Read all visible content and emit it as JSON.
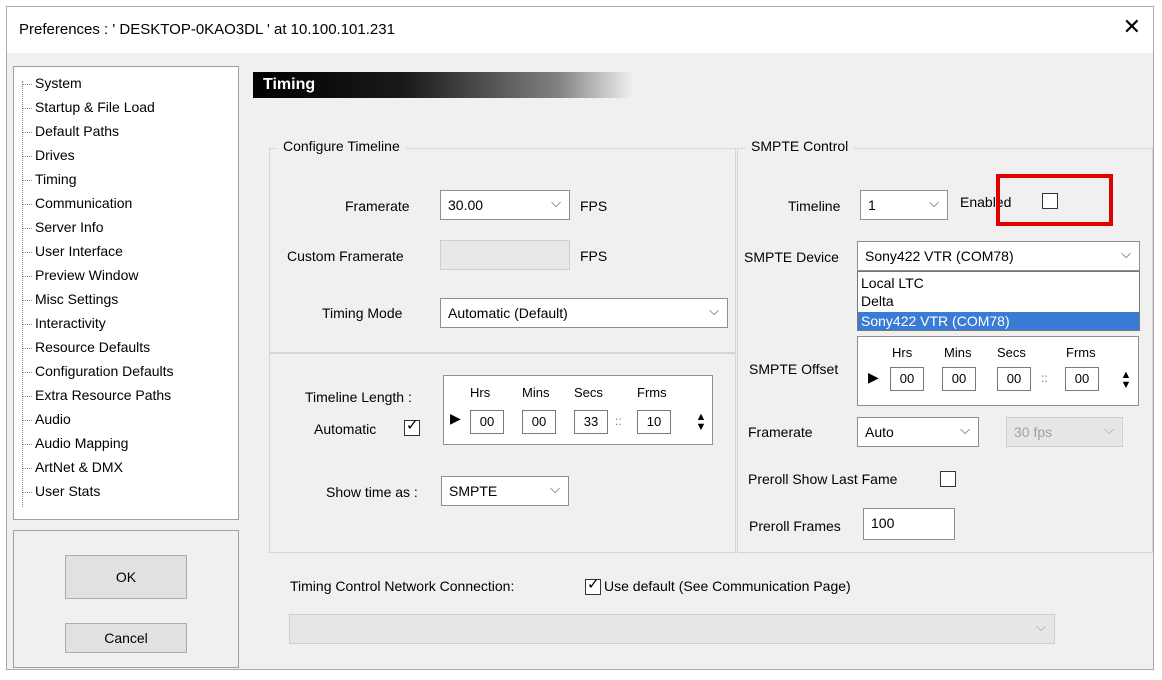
{
  "window": {
    "title": "Preferences  :  ' DESKTOP-0KAO3DL '  at  10.100.101.231"
  },
  "sidebar": {
    "items": [
      "System",
      "Startup & File Load",
      "Default Paths",
      "Drives",
      "Timing",
      "Communication",
      "Server Info",
      "User Interface",
      "Preview Window",
      "Misc Settings",
      "Interactivity",
      "Resource Defaults",
      "Configuration Defaults",
      "Extra Resource Paths",
      "Audio",
      "Audio Mapping",
      "ArtNet & DMX",
      "User Stats"
    ]
  },
  "buttons": {
    "ok": "OK",
    "cancel": "Cancel"
  },
  "header": "Timing",
  "configure": {
    "title": "Configure Timeline",
    "framerate_label": "Framerate",
    "framerate_value": "30.00",
    "fps": "FPS",
    "custom_label": "Custom Framerate",
    "custom_fps": "FPS",
    "timing_mode_label": "Timing Mode",
    "timing_mode_value": "Automatic (Default)",
    "timeline_length_label": "Timeline Length :",
    "automatic_label": "Automatic",
    "tc_headers": [
      "Hrs",
      "Mins",
      "Secs",
      "Frms"
    ],
    "tc_values": [
      "00",
      "00",
      "33",
      "10"
    ],
    "show_time_label": "Show time as :",
    "show_time_value": "SMPTE"
  },
  "smpte": {
    "title": "SMPTE Control",
    "timeline_label": "Timeline",
    "timeline_value": "1",
    "enabled_label": "Enabled",
    "device_label": "SMPTE Device",
    "device_value": "Sony422 VTR (COM78)",
    "device_options": [
      "Local LTC",
      "Delta",
      "Sony422 VTR (COM78)"
    ],
    "offset_label": "SMPTE Offset",
    "tc_headers": [
      "Hrs",
      "Mins",
      "Secs",
      "Frms"
    ],
    "tc_values": [
      "00",
      "00",
      "00",
      "00"
    ],
    "framerate_label": "Framerate",
    "framerate_value": "Auto",
    "framerate_fps": "30 fps",
    "preroll_show_label": "Preroll Show Last Fame",
    "preroll_frames_label": "Preroll Frames",
    "preroll_frames_value": "100"
  },
  "network": {
    "label": "Timing Control Network Connection:",
    "use_default_label": "Use default (See Communication Page)"
  }
}
